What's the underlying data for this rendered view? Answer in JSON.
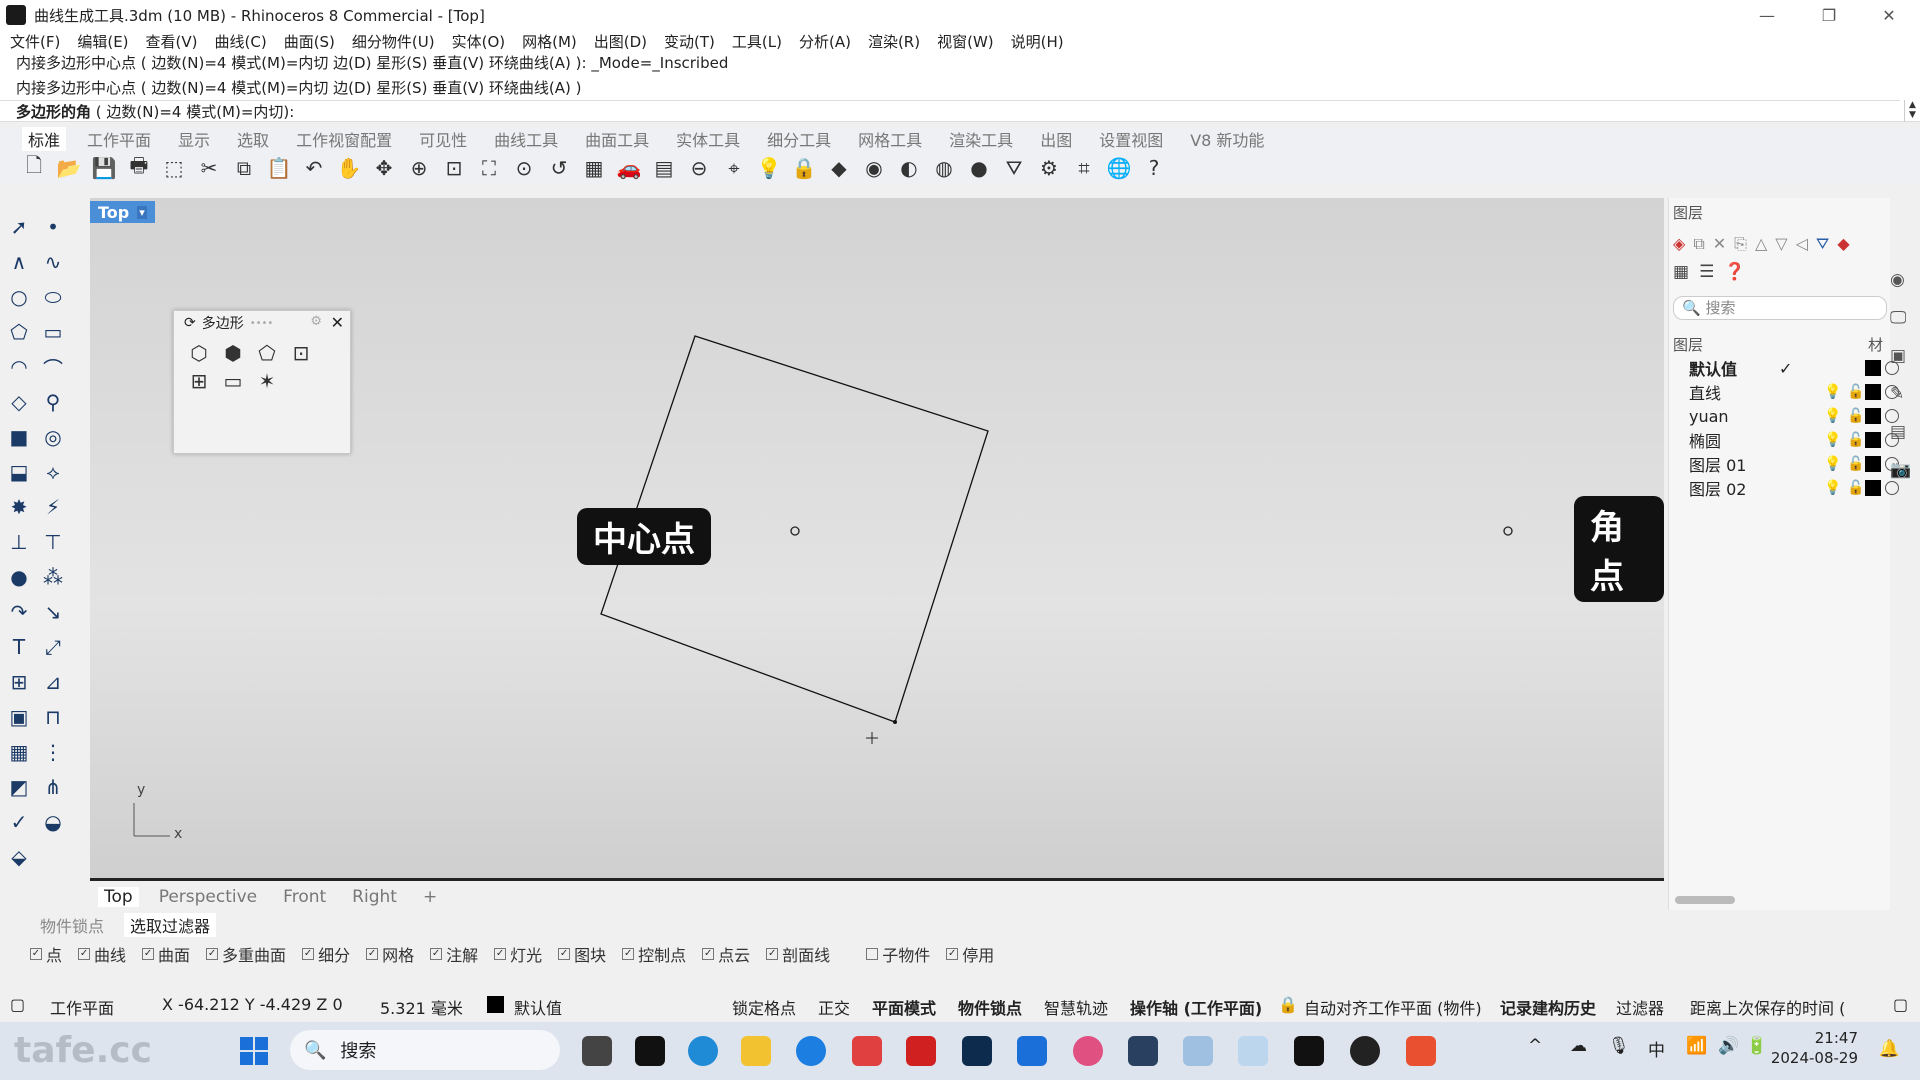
{
  "window": {
    "title": "曲线生成工具.3dm (10 MB) - Rhinoceros 8 Commercial - [Top]",
    "minimize": "—",
    "restore": "❐",
    "close": "✕"
  },
  "menu": [
    "文件(F)",
    "编辑(E)",
    "查看(V)",
    "曲线(C)",
    "曲面(S)",
    "细分物件(U)",
    "实体(O)",
    "网格(M)",
    "出图(D)",
    "变动(T)",
    "工具(L)",
    "分析(A)",
    "渲染(R)",
    "视窗(W)",
    "说明(H)"
  ],
  "command": {
    "history1": "内接多边形中心点 ( 边数(N)=4  模式(M)=内切  边(D)  星形(S)  垂直(V)  环绕曲线(A) ): _Mode=_Inscribed",
    "history2": "内接多边形中心点 ( 边数(N)=4  模式(M)=内切  边(D)  星形(S)  垂直(V)  环绕曲线(A) )",
    "prompt_bold": "多边形的角",
    "prompt_rest": " ( 边数(N)=4  模式(M)=内切):",
    "scroll_up": "▲",
    "scroll_down": "▼"
  },
  "ribbon_tabs": [
    "标准",
    "工作平面",
    "显示",
    "选取",
    "工作视窗配置",
    "可见性",
    "曲线工具",
    "曲面工具",
    "实体工具",
    "细分工具",
    "网格工具",
    "渲染工具",
    "出图",
    "设置视图",
    "V8 新功能"
  ],
  "toolbar_icons": [
    "new-icon",
    "open-icon",
    "save-icon",
    "print-icon",
    "export-icon",
    "cut-icon",
    "copy-icon",
    "paste-icon",
    "undo-icon",
    "pan-icon",
    "rotate-view-icon",
    "zoom-icon",
    "zoom-window-icon",
    "zoom-extents-icon",
    "zoom-selected-icon",
    "undo-view-icon",
    "four-view-icon",
    "car-icon",
    "grid-icon",
    "layer-icon",
    "snap-icon",
    "light-icon",
    "lock-icon",
    "material-icon",
    "color-wheel-icon",
    "shade-icon",
    "render-icon",
    "sphere-icon",
    "filter-icon",
    "gear-icon",
    "dimension-icon",
    "globe-icon",
    "help-icon"
  ],
  "toolbar_glyphs": [
    "🗋",
    "📂",
    "💾",
    "🖶",
    "⬚",
    "✂",
    "⧉",
    "📋",
    "↶",
    "✋",
    "✥",
    "⊕",
    "⊡",
    "⛶",
    "⊙",
    "↺",
    "▦",
    "🚗",
    "▤",
    "⊖",
    "⌖",
    "💡",
    "🔒",
    "◆",
    "◉",
    "◐",
    "◍",
    "●",
    "⛛",
    "⚙",
    "⌗",
    "🌐",
    "?"
  ],
  "viewport": {
    "name": "Top",
    "caret": "▾",
    "center_label": "中心点",
    "corner_label": "角点",
    "axis_x": "x",
    "axis_y": "y"
  },
  "polygon_panel": {
    "title": "多边形",
    "pin": "⟳",
    "dots": "••••",
    "gear": "⚙",
    "close": "✕",
    "tools": [
      "⬡",
      "⬢",
      "⬠",
      "⊡",
      "⊞",
      "▭",
      "✶"
    ]
  },
  "viewport_tabs": [
    "Top",
    "Perspective",
    "Front",
    "Right",
    "+"
  ],
  "layers_panel": {
    "title": "图层",
    "search_placeholder": "🔍 搜索",
    "column_layer": "图层",
    "column_material": "材",
    "layers": [
      {
        "name": "默认值",
        "current": true,
        "check": "✓"
      },
      {
        "name": "直线"
      },
      {
        "name": "yuan"
      },
      {
        "name": "椭圆"
      },
      {
        "name": "图层 01"
      },
      {
        "name": "图层 02"
      }
    ]
  },
  "bottom_tabs": [
    "物件锁点",
    "选取过滤器"
  ],
  "filters": [
    {
      "label": "点",
      "checked": true
    },
    {
      "label": "曲线",
      "checked": true
    },
    {
      "label": "曲面",
      "checked": true
    },
    {
      "label": "多重曲面",
      "checked": true
    },
    {
      "label": "细分",
      "checked": true
    },
    {
      "label": "网格",
      "checked": true
    },
    {
      "label": "注解",
      "checked": true
    },
    {
      "label": "灯光",
      "checked": true
    },
    {
      "label": "图块",
      "checked": true
    },
    {
      "label": "控制点",
      "checked": true
    },
    {
      "label": "点云",
      "checked": true
    },
    {
      "label": "剖面线",
      "checked": true
    },
    {
      "label": "子物件",
      "checked": false
    },
    {
      "label": "停用",
      "checked": true
    }
  ],
  "status": {
    "cplane": "工作平面",
    "coords": "X -64.212 Y -4.429 Z 0",
    "distance": "5.321 毫米",
    "layer": "默认值",
    "grid_snap": "锁定格点",
    "ortho": "正交",
    "planar": "平面模式",
    "osnap": "物件锁点",
    "smarttrack": "智慧轨迹",
    "gumball": "操作轴 (工作平面)",
    "autoalign": "自动对齐工作平面 (物件)",
    "history": "记录建构历史",
    "filter": "过滤器",
    "last_save": "距离上次保存的时间 ("
  },
  "taskbar": {
    "watermark": "tafe.cc",
    "search": "搜索",
    "time": "21:47",
    "date": "2024-08-29",
    "ime": "中",
    "colors": {
      "accent": "#1a6fd8",
      "viewport_tab": "#4a8ed8"
    }
  }
}
